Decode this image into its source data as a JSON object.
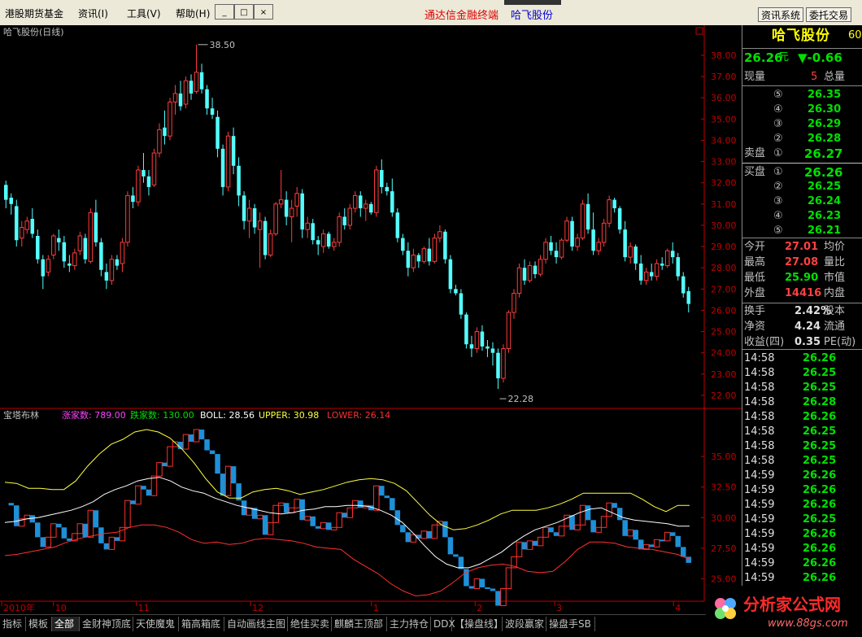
{
  "menu": [
    "港股期货基金",
    "资讯(I)",
    "工具(V)",
    "帮助(H)"
  ],
  "center_title": "通达信金融终端",
  "center_stock": "哈飞股份",
  "top_buttons": [
    "资讯系统",
    "委托交易"
  ],
  "window_buttons": [
    "_",
    "□",
    "×"
  ],
  "main_chart_title": "哈飞股份(日线)",
  "price_axis": [
    "38.00",
    "37.00",
    "36.00",
    "35.00",
    "34.00",
    "33.00",
    "32.00",
    "31.00",
    "30.00",
    "29.00",
    "28.00",
    "27.00",
    "26.00",
    "25.00",
    "24.00",
    "23.00",
    "22.00"
  ],
  "annotations": {
    "high": "38.50",
    "low": "22.28"
  },
  "indicator": {
    "name": "宝塔布林",
    "up_label": "涨家数: 789.00",
    "down_label": "跌家数: 130.00",
    "boll_label": "BOLL: 28.56",
    "upper_label": "UPPER: 30.98",
    "lower_label": "LOWER: 26.14",
    "axis": [
      "35.00",
      "32.50",
      "30.00",
      "27.50",
      "25.00"
    ]
  },
  "time_axis": [
    "2010年",
    "10",
    "11",
    "12",
    "1",
    "2",
    "3",
    "4"
  ],
  "tabs": [
    "指标",
    "模板",
    "全部",
    "金财神顶底",
    "天使魔鬼",
    "箱高箱底",
    "自动画线主图",
    "绝佳买卖",
    "麒麟王顶部",
    "主力持仓",
    "DDX",
    "【操盘线】",
    "波段赢家",
    "操盘手SB"
  ],
  "quote": {
    "name": "哈飞股份",
    "code_fragment": "60",
    "price": "26.26",
    "unit": "元",
    "change": "▼-0.66",
    "volume_label": "现量",
    "volume": "5",
    "total_label": "总量",
    "sell": [
      {
        "n": "⑤",
        "p": "26.35"
      },
      {
        "n": "④",
        "p": "26.30"
      },
      {
        "n": "③",
        "p": "26.29"
      },
      {
        "n": "②",
        "p": "26.28"
      },
      {
        "n": "①",
        "p": "26.27"
      }
    ],
    "sell_label": "卖盘",
    "buy_label": "买盘",
    "buy": [
      {
        "n": "①",
        "p": "26.26"
      },
      {
        "n": "②",
        "p": "26.25"
      },
      {
        "n": "③",
        "p": "26.24"
      },
      {
        "n": "④",
        "p": "26.23"
      },
      {
        "n": "⑤",
        "p": "26.21"
      }
    ],
    "stats": [
      {
        "l": "今开",
        "v": "27.01",
        "r": "均价",
        "c": "#ff4040"
      },
      {
        "l": "最高",
        "v": "27.08",
        "r": "量比",
        "c": "#ff4040"
      },
      {
        "l": "最低",
        "v": "25.90",
        "r": "市值",
        "c": "#00e000"
      },
      {
        "l": "外盘",
        "v": "14416",
        "r": "内盘",
        "c": "#ff4040"
      }
    ],
    "stats2": [
      {
        "l": "换手",
        "v": "2.42%",
        "r": "股本"
      },
      {
        "l": "净资",
        "v": "4.24",
        "r": "流通"
      },
      {
        "l": "收益(四)",
        "v": "0.35",
        "r": "PE(动)"
      }
    ],
    "ticks": [
      {
        "t": "14:58",
        "p": "26.26"
      },
      {
        "t": "14:58",
        "p": "26.25"
      },
      {
        "t": "14:58",
        "p": "26.25"
      },
      {
        "t": "14:58",
        "p": "26.28"
      },
      {
        "t": "14:58",
        "p": "26.26"
      },
      {
        "t": "14:58",
        "p": "26.25"
      },
      {
        "t": "14:58",
        "p": "26.25"
      },
      {
        "t": "14:58",
        "p": "26.25"
      },
      {
        "t": "14:59",
        "p": "26.26"
      },
      {
        "t": "14:59",
        "p": "26.26"
      },
      {
        "t": "14:59",
        "p": "26.26"
      },
      {
        "t": "14:59",
        "p": "26.25"
      },
      {
        "t": "14:59",
        "p": "26.26"
      },
      {
        "t": "14:59",
        "p": "26.26"
      },
      {
        "t": "14:59",
        "p": "26.26"
      },
      {
        "t": "14:59",
        "p": "26.26"
      }
    ]
  },
  "logo": {
    "text": "分析家公式网",
    "url": "www.88gs.com"
  },
  "colors": {
    "up": "#ff3c3c",
    "down": "#54ffff",
    "ma_upper": "#ffff40",
    "ma_mid": "#ffffff",
    "ma_lower": "#ff3030",
    "tower_up": "#ff3030",
    "tower_down": "#1e90d8",
    "axis": "#c00000"
  },
  "chart_data": [
    {
      "type": "candlestick",
      "title": "哈飞股份(日线)",
      "ylim": [
        21.5,
        38.8
      ],
      "x_start": "2010-09-28",
      "ohlc": [
        [
          31.9,
          32.1,
          30.8,
          31.2
        ],
        [
          31.3,
          31.5,
          30.5,
          31.0
        ],
        [
          30.9,
          31.2,
          29.0,
          29.3
        ],
        [
          29.4,
          30.2,
          29.0,
          29.9
        ],
        [
          29.8,
          30.4,
          29.6,
          30.2
        ],
        [
          30.3,
          30.8,
          29.4,
          29.6
        ],
        [
          29.5,
          29.8,
          28.2,
          28.4
        ],
        [
          28.4,
          28.6,
          27.0,
          27.6
        ],
        [
          27.8,
          28.6,
          27.6,
          28.4
        ],
        [
          28.6,
          29.6,
          28.4,
          29.5
        ],
        [
          29.4,
          29.8,
          28.8,
          29.2
        ],
        [
          29.2,
          29.5,
          28.0,
          28.3
        ],
        [
          28.2,
          28.6,
          27.8,
          28.1
        ],
        [
          28.1,
          28.9,
          27.9,
          28.7
        ],
        [
          28.8,
          29.7,
          28.6,
          29.5
        ],
        [
          29.4,
          29.6,
          28.2,
          28.4
        ],
        [
          28.3,
          30.8,
          28.2,
          30.6
        ],
        [
          30.6,
          31.2,
          29.0,
          29.2
        ],
        [
          29.2,
          29.4,
          27.6,
          27.9
        ],
        [
          27.8,
          28.2,
          27.0,
          27.4
        ],
        [
          27.4,
          28.6,
          27.2,
          28.4
        ],
        [
          28.4,
          28.6,
          27.9,
          28.1
        ],
        [
          28.2,
          29.4,
          27.8,
          29.2
        ],
        [
          29.2,
          31.6,
          29.0,
          31.4
        ],
        [
          31.4,
          31.8,
          30.8,
          31.1
        ],
        [
          31.1,
          32.8,
          30.9,
          32.6
        ],
        [
          32.6,
          33.4,
          32.0,
          32.3
        ],
        [
          32.3,
          32.6,
          31.4,
          31.8
        ],
        [
          31.9,
          33.6,
          31.8,
          33.4
        ],
        [
          33.4,
          34.8,
          33.2,
          34.5
        ],
        [
          34.6,
          35.4,
          33.8,
          34.2
        ],
        [
          34.2,
          36.0,
          34.0,
          35.8
        ],
        [
          35.8,
          36.6,
          35.2,
          36.2
        ],
        [
          36.2,
          36.8,
          35.4,
          35.6
        ],
        [
          35.7,
          37.0,
          35.5,
          36.8
        ],
        [
          36.8,
          37.1,
          35.9,
          36.2
        ],
        [
          36.3,
          38.5,
          36.2,
          37.2
        ],
        [
          37.2,
          37.6,
          36.2,
          36.4
        ],
        [
          36.4,
          36.6,
          35.2,
          35.5
        ],
        [
          35.5,
          36.0,
          35.0,
          35.2
        ],
        [
          35.1,
          35.4,
          33.2,
          33.6
        ],
        [
          33.6,
          33.8,
          31.4,
          31.8
        ],
        [
          31.8,
          34.4,
          31.6,
          34.2
        ],
        [
          34.2,
          34.6,
          32.4,
          32.8
        ],
        [
          32.8,
          33.2,
          30.9,
          31.4
        ],
        [
          31.4,
          31.6,
          29.8,
          30.2
        ],
        [
          30.2,
          31.2,
          29.4,
          30.8
        ],
        [
          30.8,
          31.0,
          29.6,
          29.9
        ],
        [
          29.8,
          30.6,
          28.0,
          30.2
        ],
        [
          30.2,
          30.4,
          28.4,
          28.6
        ],
        [
          28.6,
          29.8,
          28.5,
          29.6
        ],
        [
          29.6,
          31.1,
          29.5,
          31.0
        ],
        [
          31.0,
          32.6,
          30.8,
          31.2
        ],
        [
          31.2,
          31.6,
          30.0,
          30.4
        ],
        [
          30.4,
          31.2,
          29.2,
          30.8
        ],
        [
          30.9,
          31.8,
          30.4,
          31.5
        ],
        [
          31.5,
          31.7,
          29.4,
          29.8
        ],
        [
          29.8,
          30.4,
          29.4,
          30.1
        ],
        [
          30.1,
          30.3,
          29.1,
          29.3
        ],
        [
          29.3,
          29.5,
          28.6,
          29.1
        ],
        [
          29.0,
          29.8,
          28.7,
          29.6
        ],
        [
          29.6,
          29.7,
          28.9,
          29.0
        ],
        [
          29.0,
          29.4,
          28.8,
          29.2
        ],
        [
          29.2,
          30.6,
          29.0,
          30.4
        ],
        [
          30.4,
          30.8,
          29.8,
          30.0
        ],
        [
          30.0,
          31.0,
          29.8,
          30.8
        ],
        [
          30.8,
          31.6,
          30.6,
          31.4
        ],
        [
          31.4,
          31.6,
          30.4,
          30.8
        ],
        [
          30.8,
          31.2,
          30.2,
          31.0
        ],
        [
          31.0,
          31.1,
          30.5,
          30.6
        ],
        [
          30.6,
          32.8,
          30.4,
          32.6
        ],
        [
          32.6,
          33.1,
          31.5,
          31.8
        ],
        [
          31.8,
          32.0,
          31.4,
          31.6
        ],
        [
          31.6,
          32.2,
          30.4,
          30.6
        ],
        [
          30.6,
          30.8,
          29.2,
          29.4
        ],
        [
          29.4,
          29.6,
          28.6,
          28.8
        ],
        [
          28.8,
          29.2,
          27.6,
          28.0
        ],
        [
          28.0,
          28.9,
          27.8,
          28.6
        ],
        [
          28.6,
          28.7,
          28.0,
          28.3
        ],
        [
          28.3,
          29.0,
          28.2,
          28.9
        ],
        [
          28.9,
          29.4,
          28.1,
          28.3
        ],
        [
          28.3,
          29.6,
          28.2,
          29.4
        ],
        [
          29.4,
          30.0,
          29.2,
          29.7
        ],
        [
          29.7,
          29.8,
          28.2,
          28.4
        ],
        [
          28.4,
          28.6,
          26.8,
          27.0
        ],
        [
          27.0,
          27.2,
          26.7,
          26.8
        ],
        [
          26.8,
          27.0,
          25.6,
          25.8
        ],
        [
          25.8,
          25.9,
          24.2,
          24.4
        ],
        [
          24.4,
          24.8,
          23.8,
          24.2
        ],
        [
          24.2,
          25.2,
          24.0,
          25.0
        ],
        [
          25.0,
          25.3,
          24.1,
          24.3
        ],
        [
          24.3,
          24.6,
          23.8,
          24.2
        ],
        [
          24.2,
          24.5,
          23.4,
          24.0
        ],
        [
          24.0,
          24.2,
          22.3,
          22.8
        ],
        [
          22.8,
          24.4,
          22.6,
          24.2
        ],
        [
          24.2,
          26.0,
          24.0,
          25.9
        ],
        [
          25.9,
          27.0,
          25.6,
          26.8
        ],
        [
          26.8,
          28.2,
          26.6,
          28.0
        ],
        [
          28.0,
          28.4,
          27.2,
          27.4
        ],
        [
          27.4,
          28.3,
          27.3,
          28.1
        ],
        [
          28.1,
          28.3,
          27.5,
          27.7
        ],
        [
          27.7,
          28.6,
          27.6,
          28.4
        ],
        [
          28.4,
          29.4,
          28.2,
          29.2
        ],
        [
          29.2,
          29.5,
          28.6,
          28.8
        ],
        [
          28.8,
          29.2,
          28.2,
          28.5
        ],
        [
          28.5,
          29.4,
          28.4,
          29.3
        ],
        [
          29.3,
          30.4,
          29.2,
          30.2
        ],
        [
          30.2,
          30.4,
          28.8,
          29.0
        ],
        [
          29.0,
          29.6,
          28.8,
          29.4
        ],
        [
          29.4,
          31.2,
          29.3,
          31.0
        ],
        [
          31.0,
          31.5,
          29.6,
          29.8
        ],
        [
          29.8,
          30.6,
          28.6,
          28.8
        ],
        [
          28.8,
          29.4,
          28.6,
          29.2
        ],
        [
          29.2,
          30.3,
          29.0,
          30.1
        ],
        [
          30.1,
          31.4,
          29.9,
          31.2
        ],
        [
          31.2,
          31.3,
          30.6,
          30.8
        ],
        [
          30.8,
          30.9,
          29.6,
          29.8
        ],
        [
          29.8,
          30.2,
          28.3,
          28.5
        ],
        [
          28.5,
          29.2,
          28.2,
          29.0
        ],
        [
          29.0,
          29.1,
          27.9,
          28.2
        ],
        [
          28.2,
          28.6,
          27.2,
          27.4
        ],
        [
          27.4,
          28.0,
          27.2,
          27.8
        ],
        [
          27.8,
          28.2,
          27.4,
          27.6
        ],
        [
          27.6,
          28.4,
          27.4,
          28.2
        ],
        [
          28.2,
          28.5,
          27.9,
          28.1
        ],
        [
          28.1,
          28.9,
          28.0,
          28.8
        ],
        [
          28.8,
          29.2,
          28.2,
          28.5
        ],
        [
          28.5,
          28.7,
          27.4,
          27.6
        ],
        [
          27.6,
          27.8,
          26.6,
          26.8
        ],
        [
          26.9,
          27.1,
          25.9,
          26.3
        ]
      ]
    },
    {
      "type": "line",
      "title": "宝塔布林",
      "ylim": [
        23.3,
        37.8
      ],
      "series": [
        {
          "name": "BOLL",
          "values": [
            29.6,
            29.7,
            29.9,
            30.0,
            30.2,
            30.4,
            30.6,
            30.9,
            31.3,
            31.9,
            32.3,
            32.6,
            33.0,
            33.2,
            33.3,
            33.0,
            32.5,
            32.2,
            32.0,
            31.6,
            31.3,
            31.0,
            30.8,
            30.6,
            30.4,
            30.3,
            30.4,
            30.6,
            30.7,
            30.9,
            30.9,
            31.0,
            31.0,
            30.9,
            30.6,
            30.2,
            29.6,
            28.7,
            27.7,
            26.8,
            26.2,
            25.9,
            25.9,
            26.2,
            26.7,
            27.2,
            27.9,
            28.5,
            29.0,
            29.3,
            29.6,
            30.0,
            30.4,
            30.7,
            30.8,
            30.4,
            30.0,
            29.8,
            29.7,
            29.6,
            29.5,
            29.3,
            29.3
          ]
        },
        {
          "name": "UPPER",
          "values": [
            32.9,
            32.8,
            32.4,
            32.4,
            32.3,
            32.3,
            33.0,
            34.2,
            35.2,
            36.0,
            36.4,
            37.0,
            37.2,
            37.0,
            36.5,
            35.6,
            34.5,
            33.2,
            32.1,
            31.6,
            31.6,
            32.1,
            32.3,
            32.4,
            32.2,
            31.9,
            32.1,
            32.3,
            32.6,
            32.9,
            33.1,
            33.2,
            33.1,
            32.8,
            32.2,
            31.2,
            30.2,
            29.4,
            29.0,
            29.1,
            29.4,
            29.8,
            30.3,
            30.6,
            30.6,
            30.6,
            30.8,
            31.1,
            31.5,
            32.0,
            32.0,
            32.0,
            32.0,
            32.0,
            31.5,
            30.9,
            30.5,
            31.0,
            31.0
          ]
        },
        {
          "name": "LOWER",
          "values": [
            26.9,
            27.0,
            27.2,
            27.4,
            27.6,
            28.0,
            28.3,
            28.5,
            28.7,
            28.8,
            29.2,
            29.4,
            29.4,
            29.2,
            28.8,
            28.2,
            27.9,
            28.0,
            27.8,
            27.9,
            28.2,
            28.3,
            28.2,
            28.1,
            27.9,
            27.6,
            27.5,
            27.4,
            26.6,
            26.0,
            25.4,
            24.6,
            24.0,
            23.6,
            23.7,
            24.0,
            24.7,
            25.5,
            25.9,
            26.1,
            26.2,
            26.0,
            25.6,
            25.5,
            25.6,
            26.4,
            27.4,
            28.0,
            28.0,
            27.9,
            27.6,
            27.5,
            27.4,
            27.2,
            27.0,
            26.6
          ]
        }
      ]
    }
  ]
}
